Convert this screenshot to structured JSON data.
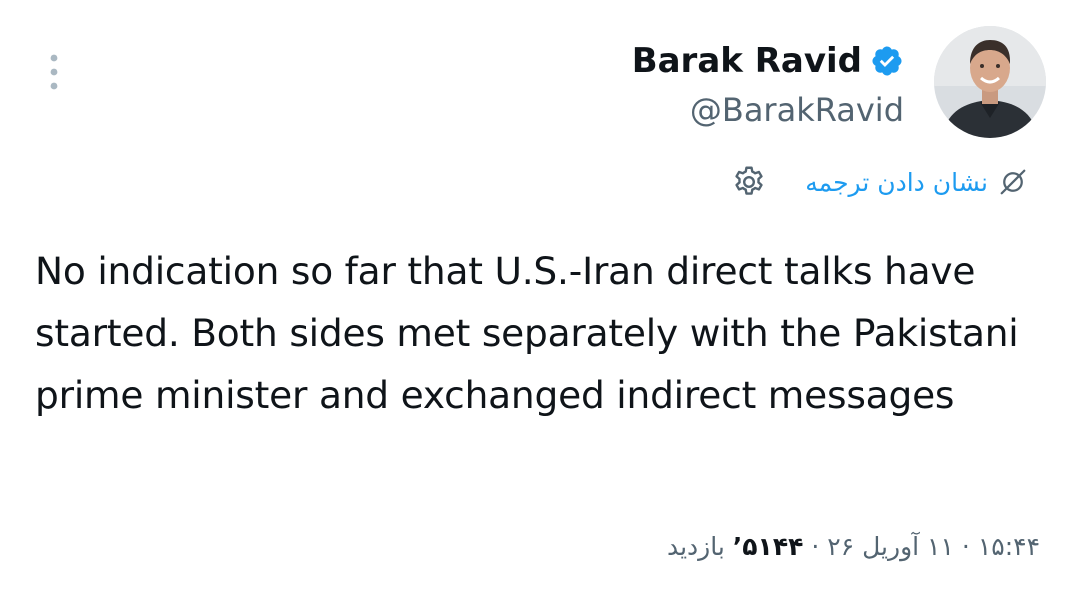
{
  "icons": {
    "more": "more-vertical-icon",
    "verified": "verified-badge-icon",
    "settings": "gear-icon",
    "translate": "translate-icon",
    "avatar": "avatar"
  },
  "colors": {
    "accent": "#1d9bf0",
    "text": "#0f1419",
    "secondary": "#536471"
  },
  "author": {
    "display_name": "Barak Ravid",
    "handle": "@BarakRavid"
  },
  "translate": {
    "label": "نشان دادن ترجمه"
  },
  "tweet": {
    "text": "No indication so far that U.S.-Iran direct talks have started. Both sides met separately with the Pakistani prime minister and exchanged indirect messages"
  },
  "meta": {
    "time": "۱۵:۴۴",
    "date": "۱۱ آوریل ۲۶",
    "views_count": "۵۱۴۴’",
    "views_label": "بازدید",
    "separator": "·"
  }
}
